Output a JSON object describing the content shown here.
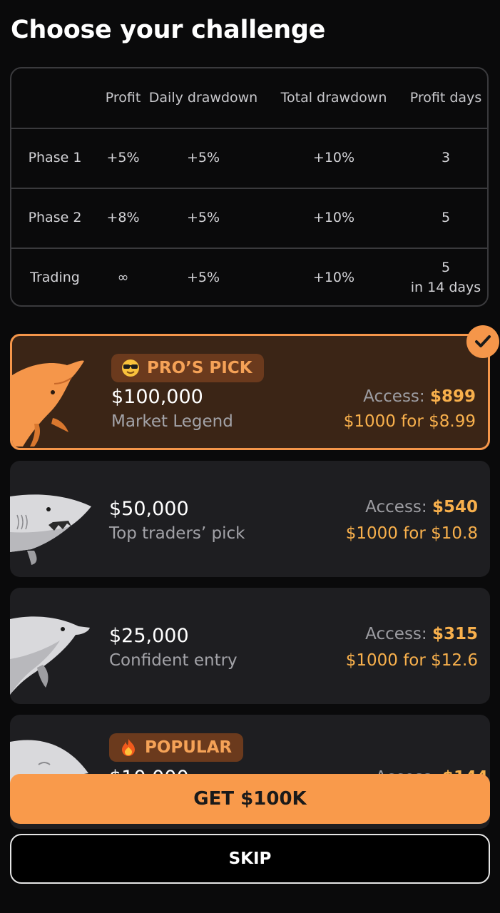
{
  "page": {
    "title": "Choose your challenge"
  },
  "rules_table": {
    "headers": [
      "",
      "Profit",
      "Daily drawdown",
      "Total drawdown",
      "Profit days"
    ],
    "rows": [
      {
        "label": "Phase 1",
        "profit": "+5%",
        "daily": "+5%",
        "total": "+10%",
        "days": "3",
        "days_note": ""
      },
      {
        "label": "Phase 2",
        "profit": "+8%",
        "daily": "+5%",
        "total": "+10%",
        "days": "5",
        "days_note": ""
      },
      {
        "label": "Trading",
        "profit": "∞",
        "daily": "+5%",
        "total": "+10%",
        "days": "5",
        "days_note": "in 14 days"
      }
    ]
  },
  "plans": [
    {
      "badge": "PRO’S PICK",
      "badge_icon": "sunglasses-emoji-icon",
      "amount": "$100,000",
      "name": "Market Legend",
      "access_label": "Access:",
      "access_price": "$899",
      "per_1000": "$1000 for $8.99",
      "animal": "whale-icon",
      "selected": true
    },
    {
      "badge": "",
      "amount": "$50,000",
      "name": "Top traders’ pick",
      "access_label": "Access:",
      "access_price": "$540",
      "per_1000": "$1000 for $10.8",
      "animal": "shark-icon",
      "selected": false
    },
    {
      "badge": "",
      "amount": "$25,000",
      "name": "Confident entry",
      "access_label": "Access:",
      "access_price": "$315",
      "per_1000": "$1000 for $12.6",
      "animal": "dolphin-icon",
      "selected": false
    },
    {
      "badge": "POPULAR",
      "badge_icon": "fire-emoji-icon",
      "amount": "$10,000",
      "access_label": "Access:",
      "access_price": "$144",
      "animal": "fish-icon",
      "selected": false
    }
  ],
  "buttons": {
    "primary": "GET $100K",
    "secondary": "SKIP"
  },
  "colors": {
    "accent": "#f5964a",
    "price": "#f8b04c",
    "selected_bg": "#3b2516",
    "card_bg": "#1e1e21"
  }
}
